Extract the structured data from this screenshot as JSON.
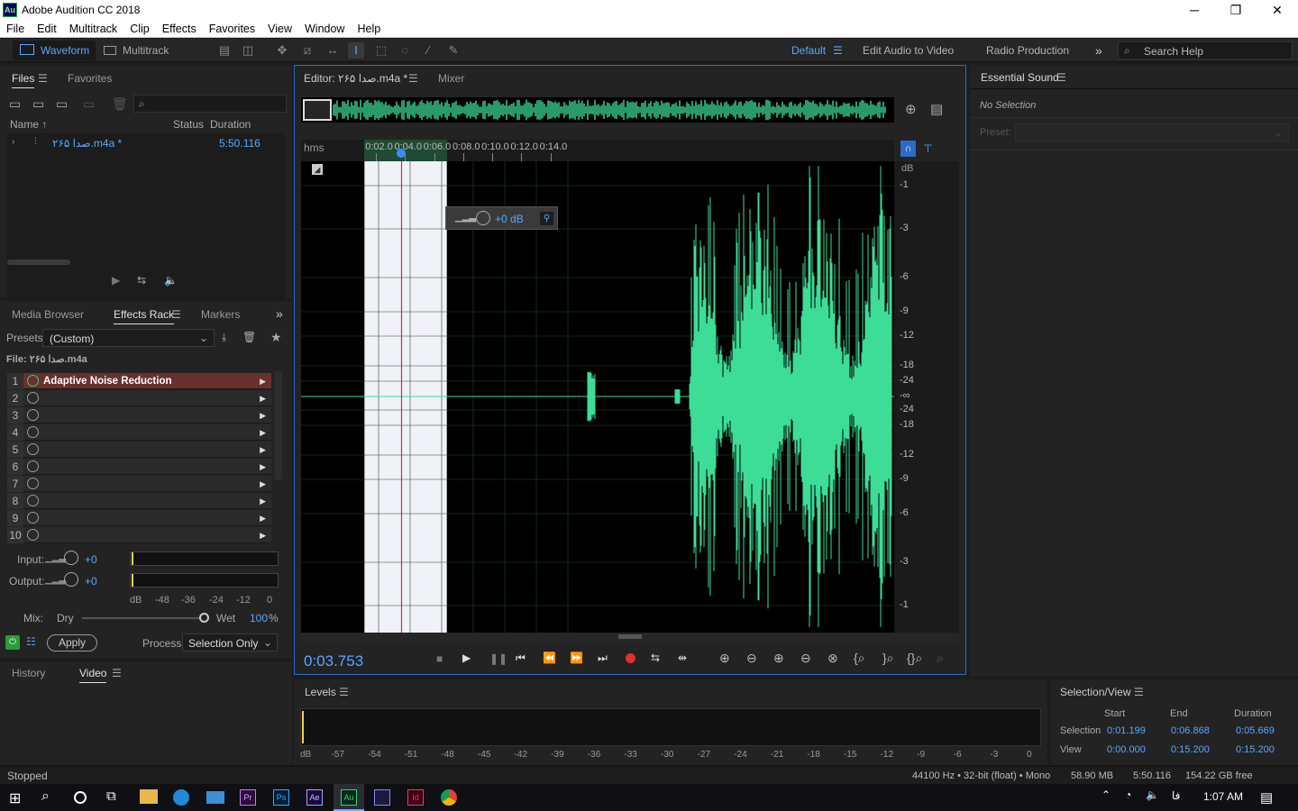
{
  "window": {
    "title": "Adobe Audition CC 2018",
    "app_icon": "Au",
    "min": "─",
    "max": "❐",
    "close": "✕"
  },
  "menu": [
    "File",
    "Edit",
    "Multitrack",
    "Clip",
    "Effects",
    "Favorites",
    "View",
    "Window",
    "Help"
  ],
  "toolbar": {
    "waveform": "Waveform",
    "multitrack": "Multitrack",
    "workspace_default": "Default",
    "workspace_edit_video": "Edit Audio to Video",
    "workspace_radio": "Radio Production",
    "overflow": "»",
    "search_placeholder": "Search Help"
  },
  "files": {
    "tab_files": "Files",
    "tab_favorites": "Favorites",
    "col_name": "Name",
    "col_status": "Status",
    "col_duration": "Duration",
    "file_name": "صدا ۲۶۵.m4a *",
    "file_duration": "5:50.116"
  },
  "effects": {
    "tab_media": "Media Browser",
    "tab_rack": "Effects Rack",
    "tab_markers": "Markers",
    "presets_label": "Presets:",
    "presets_value": "(Custom)",
    "file_label": "File: صدا ۲۶۵.m4a",
    "rows": [
      {
        "n": "1",
        "name": "Adaptive Noise Reduction"
      },
      {
        "n": "2",
        "name": ""
      },
      {
        "n": "3",
        "name": ""
      },
      {
        "n": "4",
        "name": ""
      },
      {
        "n": "5",
        "name": ""
      },
      {
        "n": "6",
        "name": ""
      },
      {
        "n": "7",
        "name": ""
      },
      {
        "n": "8",
        "name": ""
      },
      {
        "n": "9",
        "name": ""
      },
      {
        "n": "10",
        "name": ""
      }
    ],
    "input_label": "Input:",
    "input_value": "+0",
    "output_label": "Output:",
    "output_value": "+0",
    "scale": [
      "dB",
      "-48",
      "-36",
      "-24",
      "-12",
      "0"
    ],
    "mix_label": "Mix:",
    "dry": "Dry",
    "wet": "Wet",
    "wet_value": "100",
    "wet_unit": "%",
    "mix_level": 1.0,
    "apply": "Apply",
    "process_label": "Process:",
    "process_value": "Selection Only"
  },
  "history": {
    "tab_history": "History",
    "tab_video": "Video"
  },
  "editor": {
    "tab_editor": "Editor: صدا ۲۶۵.m4a *",
    "tab_mixer": "Mixer",
    "ruler_unit": "hms",
    "ruler": [
      "0:02.0",
      "0:04.0",
      "0:06.0",
      "0:08.0",
      "0:10.0",
      "0:12.0",
      "0:14.0"
    ],
    "hud": "+0 dB",
    "db_label": "dB",
    "db_scale": [
      "-1",
      "-3",
      "-6",
      "-9",
      "-12",
      "-18",
      "-24",
      "-∞",
      "-24",
      "-18",
      "-12",
      "-9",
      "-6",
      "-3",
      "-1"
    ],
    "time": "0:03.753",
    "view_start_s": 0,
    "view_end_s": 15.2,
    "selection_start_s": 1.199,
    "selection_end_s": 6.868,
    "playhead_s": 3.753,
    "wave_color": "#3ddc97"
  },
  "levels": {
    "title": "Levels",
    "scale": [
      "dB",
      "-57",
      "-54",
      "-51",
      "-48",
      "-45",
      "-42",
      "-39",
      "-36",
      "-33",
      "-30",
      "-27",
      "-24",
      "-21",
      "-18",
      "-15",
      "-12",
      "-9",
      "-6",
      "-3",
      "0"
    ]
  },
  "essential": {
    "title": "Essential Sound",
    "no_selection": "No Selection",
    "preset_label": "Preset:"
  },
  "selview": {
    "title": "Selection/View",
    "col_start": "Start",
    "col_end": "End",
    "col_duration": "Duration",
    "sel_label": "Selection",
    "sel_start": "0:01.199",
    "sel_end": "0:06.868",
    "sel_dur": "0:05.669",
    "view_label": "View",
    "view_start": "0:00.000",
    "view_end": "0:15.200",
    "view_dur": "0:15.200"
  },
  "status": {
    "state": "Stopped",
    "format": "44100 Hz • 32-bit (float) • Mono",
    "size": "58.90 MB",
    "duration": "5:50.116",
    "free": "154.22 GB free"
  },
  "taskbar": {
    "apps": [
      "Pr",
      "Ps",
      "Ae",
      "Au",
      "Id"
    ],
    "lang": "فا",
    "clock": "1:07 AM"
  }
}
